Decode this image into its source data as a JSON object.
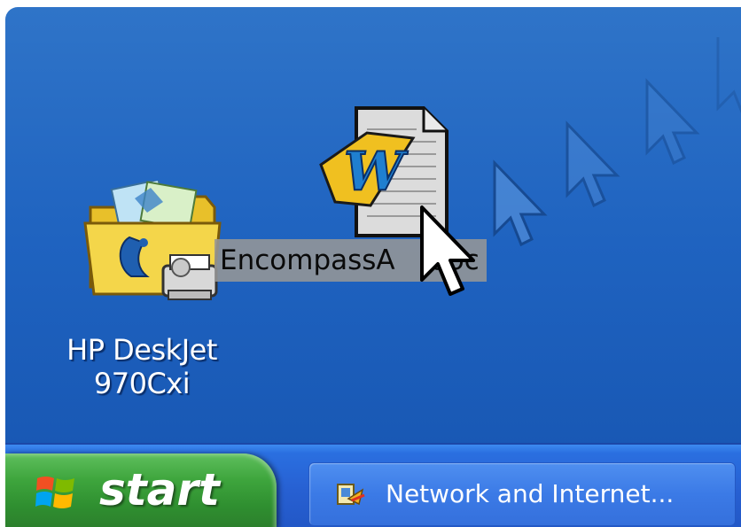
{
  "desktop": {
    "printer_icon": {
      "icon": "hp-printer-folder-icon",
      "label_line1": "HP DeskJet",
      "label_line2": "970Cxi"
    },
    "dragged_file": {
      "icon": "word-document-icon",
      "label": "EncompassA   .doc"
    },
    "cursor": "arrow-cursor",
    "cursor_trail": "arrow-cursor-trail"
  },
  "taskbar": {
    "start_label": "start",
    "task_button": {
      "icon": "network-connections-icon",
      "label": "Network and Internet..."
    }
  },
  "colors": {
    "desktop_blue": "#2466c4",
    "taskbar_blue": "#2760d2",
    "start_green": "#3ea53d"
  }
}
